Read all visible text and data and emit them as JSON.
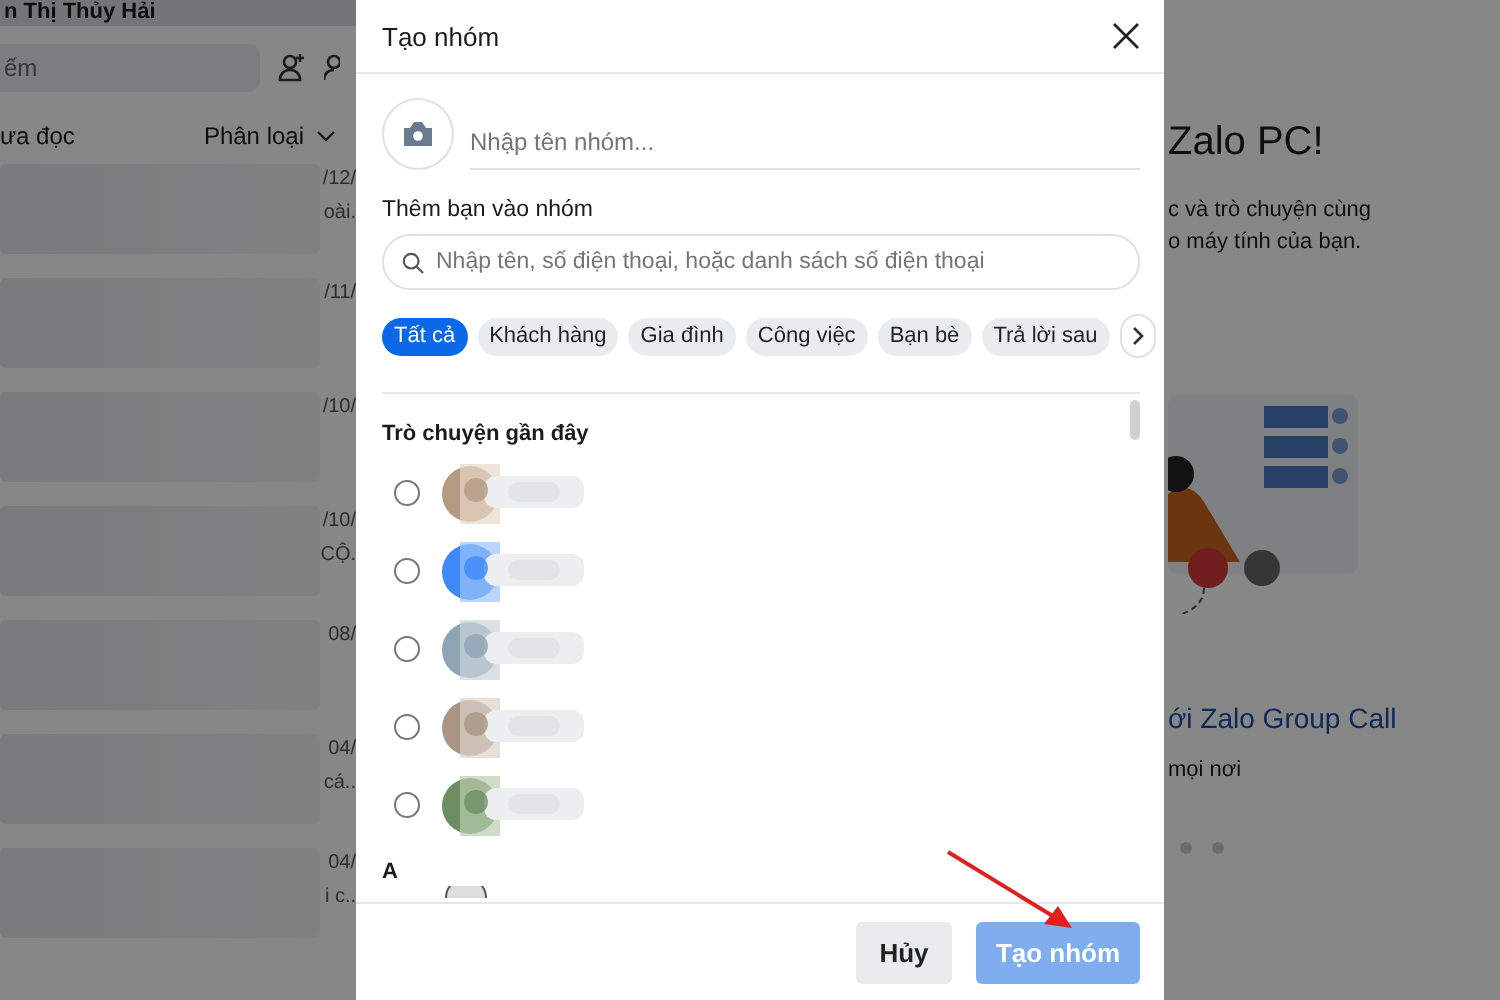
{
  "background": {
    "account_name": "n Thị Thủy Hải",
    "search_placeholder": "ếm",
    "filter_label": "ưa đọc",
    "sort_label": "Phân loại",
    "conversations": [
      {
        "time": "/12/",
        "snippet": "oài."
      },
      {
        "time": "/11/"
      },
      {
        "time": "/10/"
      },
      {
        "time": "/10/",
        "snippet": "CỘ."
      },
      {
        "time": "08/"
      },
      {
        "time": "04/",
        "snippet": "cá.."
      },
      {
        "time": "04/",
        "snippet": "i c.."
      }
    ],
    "welcome": {
      "title": "Zalo PC!",
      "lines": [
        "c và trò chuyện cùng",
        "o máy tính của bạn."
      ],
      "feature_title": "ới Zalo Group Call",
      "feature_text": "mọi nơi",
      "dots": [
        {
          "selected": false
        },
        {
          "selected": false
        }
      ]
    }
  },
  "dialog": {
    "title": "Tạo nhóm",
    "name_placeholder": "Nhập tên nhóm...",
    "add_label": "Thêm bạn vào nhóm",
    "search_placeholder": "Nhập tên, số điện thoại, hoặc danh sách số điện thoại",
    "filters": [
      {
        "label": "Tất cả",
        "selected": true
      },
      {
        "label": "Khách hàng",
        "selected": false
      },
      {
        "label": "Gia đình",
        "selected": false
      },
      {
        "label": "Công việc",
        "selected": false
      },
      {
        "label": "Bạn bè",
        "selected": false
      },
      {
        "label": "Trả lời sau",
        "selected": false
      }
    ],
    "sections": [
      {
        "title": "Trò chuyện gần đây",
        "contacts": [
          {
            "checked": false
          },
          {
            "checked": false
          },
          {
            "checked": false
          },
          {
            "checked": false
          },
          {
            "checked": false
          }
        ]
      },
      {
        "title": "A"
      }
    ],
    "cancel_button": "Hủy",
    "create_button": {
      "label": "Tạo nhóm",
      "disabled": true
    }
  }
}
